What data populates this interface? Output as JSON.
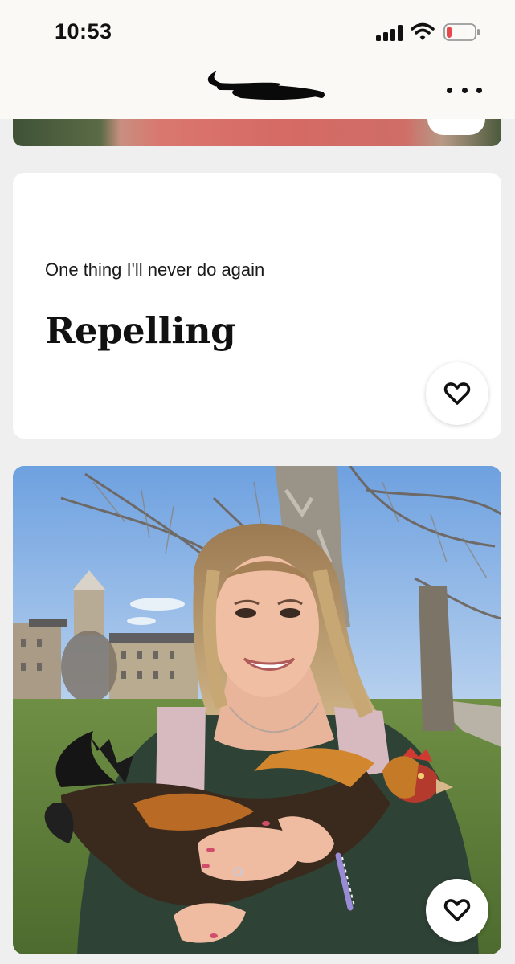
{
  "status_bar": {
    "time": "10:53",
    "signal_icon": "cellular-signal-icon",
    "wifi_icon": "wifi-icon",
    "battery_icon": "battery-low-icon",
    "battery_color": "#e5484d"
  },
  "header": {
    "name_icon": "redacted-name-scribble",
    "more_icon": "more-horizontal-icon"
  },
  "prompt": {
    "question": "One thing I'll never do again",
    "answer": "Repelling",
    "like_icon": "heart-outline-icon"
  },
  "photo": {
    "subject": "woman-holding-rooster-photo",
    "like_icon": "heart-outline-icon"
  },
  "colors": {
    "background": "#efefef",
    "card": "#ffffff",
    "header": "#faf9f6",
    "text": "#111111"
  }
}
